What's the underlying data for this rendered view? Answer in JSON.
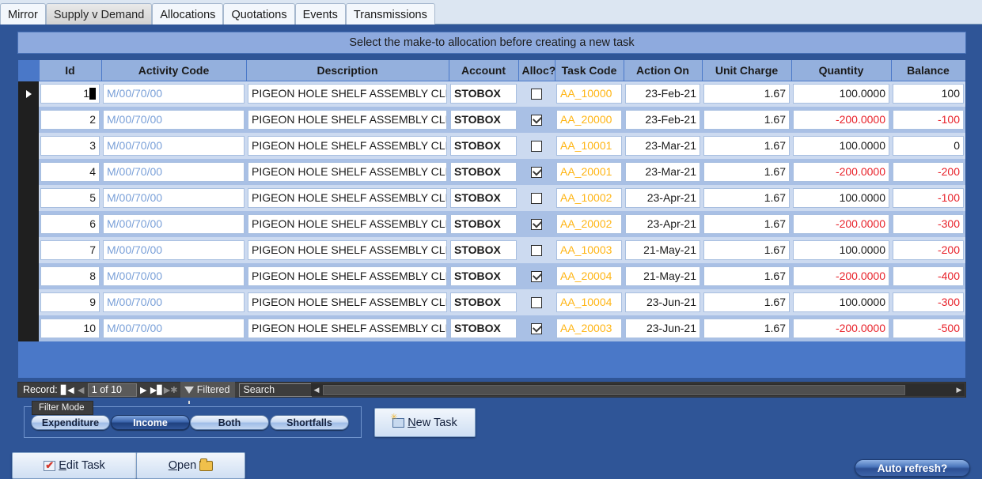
{
  "tabs": [
    {
      "label": "Mirror",
      "active": false
    },
    {
      "label": "Supply v Demand",
      "active": true
    },
    {
      "label": "Allocations",
      "active": false
    },
    {
      "label": "Quotations",
      "active": false
    },
    {
      "label": "Events",
      "active": false
    },
    {
      "label": "Transmissions",
      "active": false
    }
  ],
  "banner": {
    "message": "Select the make-to allocation before creating a new task"
  },
  "grid": {
    "columns": [
      "Id",
      "Activity Code",
      "Description",
      "Account",
      "Alloc?",
      "Task Code",
      "Action On",
      "Unit Charge",
      "Quantity",
      "Balance"
    ],
    "rows": [
      {
        "id": "1",
        "activity_code": "M/00/70/00",
        "description": "PIGEON HOLE SHELF ASSEMBLY CLEAR",
        "account": "STOBOX",
        "alloc": false,
        "task_code": "AA_10000",
        "action_on": "23-Feb-21",
        "unit_charge": "1.67",
        "quantity": "100.0000",
        "balance": "100",
        "quantity_negative": false,
        "balance_negative": false,
        "current": true
      },
      {
        "id": "2",
        "activity_code": "M/00/70/00",
        "description": "PIGEON HOLE SHELF ASSEMBLY CLEAR",
        "account": "STOBOX",
        "alloc": true,
        "task_code": "AA_20000",
        "action_on": "23-Feb-21",
        "unit_charge": "1.67",
        "quantity": "-200.0000",
        "balance": "-100",
        "quantity_negative": true,
        "balance_negative": true,
        "current": false
      },
      {
        "id": "3",
        "activity_code": "M/00/70/00",
        "description": "PIGEON HOLE SHELF ASSEMBLY CLEAR",
        "account": "STOBOX",
        "alloc": false,
        "task_code": "AA_10001",
        "action_on": "23-Mar-21",
        "unit_charge": "1.67",
        "quantity": "100.0000",
        "balance": "0",
        "quantity_negative": false,
        "balance_negative": false,
        "current": false
      },
      {
        "id": "4",
        "activity_code": "M/00/70/00",
        "description": "PIGEON HOLE SHELF ASSEMBLY CLEAR",
        "account": "STOBOX",
        "alloc": true,
        "task_code": "AA_20001",
        "action_on": "23-Mar-21",
        "unit_charge": "1.67",
        "quantity": "-200.0000",
        "balance": "-200",
        "quantity_negative": true,
        "balance_negative": true,
        "current": false
      },
      {
        "id": "5",
        "activity_code": "M/00/70/00",
        "description": "PIGEON HOLE SHELF ASSEMBLY CLEAR",
        "account": "STOBOX",
        "alloc": false,
        "task_code": "AA_10002",
        "action_on": "23-Apr-21",
        "unit_charge": "1.67",
        "quantity": "100.0000",
        "balance": "-100",
        "quantity_negative": false,
        "balance_negative": true,
        "current": false
      },
      {
        "id": "6",
        "activity_code": "M/00/70/00",
        "description": "PIGEON HOLE SHELF ASSEMBLY CLEAR",
        "account": "STOBOX",
        "alloc": true,
        "task_code": "AA_20002",
        "action_on": "23-Apr-21",
        "unit_charge": "1.67",
        "quantity": "-200.0000",
        "balance": "-300",
        "quantity_negative": true,
        "balance_negative": true,
        "current": false
      },
      {
        "id": "7",
        "activity_code": "M/00/70/00",
        "description": "PIGEON HOLE SHELF ASSEMBLY CLEAR",
        "account": "STOBOX",
        "alloc": false,
        "task_code": "AA_10003",
        "action_on": "21-May-21",
        "unit_charge": "1.67",
        "quantity": "100.0000",
        "balance": "-200",
        "quantity_negative": false,
        "balance_negative": true,
        "current": false
      },
      {
        "id": "8",
        "activity_code": "M/00/70/00",
        "description": "PIGEON HOLE SHELF ASSEMBLY CLEAR",
        "account": "STOBOX",
        "alloc": true,
        "task_code": "AA_20004",
        "action_on": "21-May-21",
        "unit_charge": "1.67",
        "quantity": "-200.0000",
        "balance": "-400",
        "quantity_negative": true,
        "balance_negative": true,
        "current": false
      },
      {
        "id": "9",
        "activity_code": "M/00/70/00",
        "description": "PIGEON HOLE SHELF ASSEMBLY CLEAR",
        "account": "STOBOX",
        "alloc": false,
        "task_code": "AA_10004",
        "action_on": "23-Jun-21",
        "unit_charge": "1.67",
        "quantity": "100.0000",
        "balance": "-300",
        "quantity_negative": false,
        "balance_negative": true,
        "current": false
      },
      {
        "id": "10",
        "activity_code": "M/00/70/00",
        "description": "PIGEON HOLE SHELF ASSEMBLY CLEAR",
        "account": "STOBOX",
        "alloc": true,
        "task_code": "AA_20003",
        "action_on": "23-Jun-21",
        "unit_charge": "1.67",
        "quantity": "-200.0000",
        "balance": "-500",
        "quantity_negative": true,
        "balance_negative": true,
        "current": false
      }
    ]
  },
  "record_nav": {
    "label": "Record:",
    "position": "1 of 10",
    "first_icon": "first-record-icon",
    "prev_icon": "previous-record-icon",
    "next_icon": "next-record-icon",
    "last_icon": "last-record-icon",
    "new_icon": "new-record-icon",
    "filter_status": "Filtered",
    "filter_icon": "funnel-icon",
    "search_placeholder": "Search",
    "search_value": ""
  },
  "filter_mode": {
    "tooltip": "Filter Mode",
    "options": [
      {
        "label": "Expenditure",
        "selected": false
      },
      {
        "label": "Income",
        "selected": true
      },
      {
        "label": "Both",
        "selected": false
      },
      {
        "label": "Shortfalls",
        "selected": false
      }
    ]
  },
  "actions": {
    "new_task": {
      "label": "New Task",
      "accel": "N",
      "icon": "new-task-icon"
    },
    "edit_task": {
      "label": "Edit Task",
      "accel": "E",
      "icon": "edit-task-icon"
    },
    "open": {
      "label": "Open",
      "accel": "O",
      "icon": "folder-open-icon"
    },
    "auto_refresh": {
      "label": "Auto refresh?"
    }
  },
  "colors": {
    "window_background": "#2f5597",
    "banner_background": "#8eaade",
    "header_background": "#94b0dd",
    "row_background": "#ccdaf0",
    "row_alt_background": "#a9c0e5",
    "activity_code_text": "#7aa0d8",
    "task_code_text": "#ffb514",
    "negative_text": "#e8222a",
    "selector_background": "#1f1f1f"
  }
}
